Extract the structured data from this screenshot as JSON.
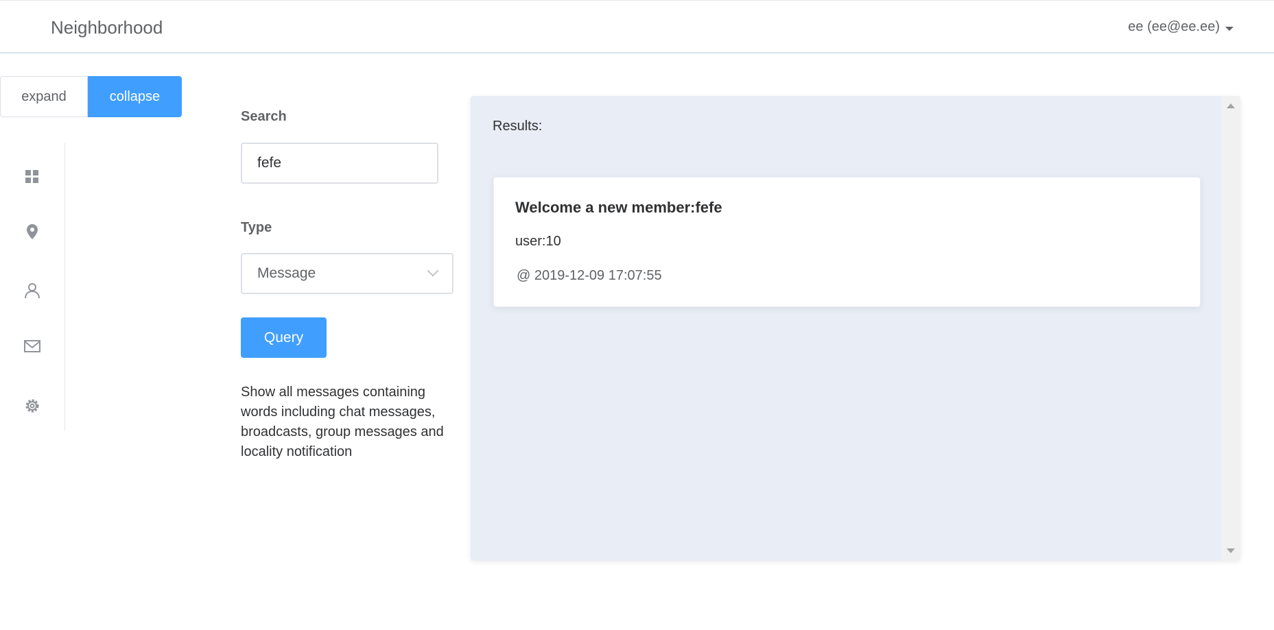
{
  "header": {
    "brand": "Neighborhood",
    "user_label": "ee (ee@ee.ee)"
  },
  "toggle": {
    "expand_label": "expand",
    "collapse_label": "collapse"
  },
  "sidebar": {
    "items": [
      {
        "icon": "dashboard-grid-icon"
      },
      {
        "icon": "location-pin-icon"
      },
      {
        "icon": "user-icon"
      },
      {
        "icon": "mail-icon"
      },
      {
        "icon": "gear-icon"
      }
    ]
  },
  "search": {
    "label": "Search",
    "value": "fefe"
  },
  "type": {
    "label": "Type",
    "selected": "Message"
  },
  "query": {
    "button_label": "Query",
    "help_text": "Show all messages containing words including chat messages, broadcasts, group messages and locality notification"
  },
  "results": {
    "label": "Results:",
    "items": [
      {
        "title": "Welcome a new member:fefe",
        "user": "user:10",
        "timestamp": "@ 2019-12-09 17:07:55"
      }
    ]
  },
  "colors": {
    "primary": "#409eff",
    "panel_bg": "#e9edf5",
    "text_primary": "#303133",
    "text_secondary": "#606266",
    "border": "#dcdfe6"
  }
}
